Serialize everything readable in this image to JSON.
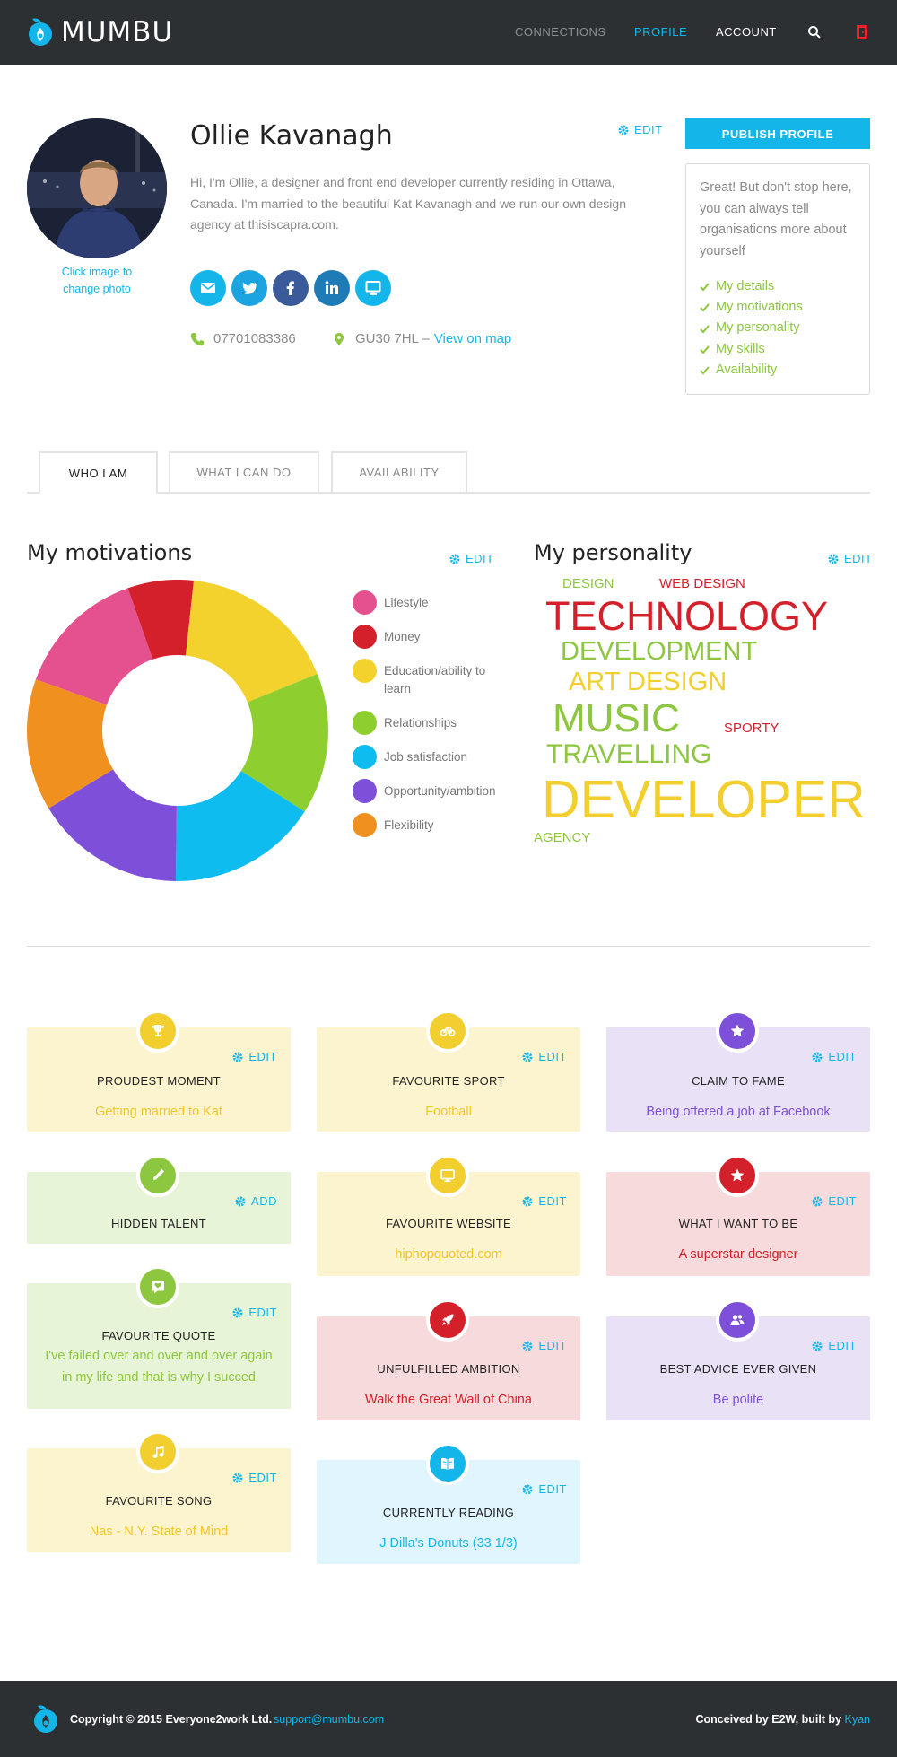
{
  "app": {
    "name": "MUMBU"
  },
  "nav": {
    "connections": "CONNECTIONS",
    "profile": "PROFILE",
    "account": "ACCOUNT",
    "search_icon": "search-icon",
    "logout_icon": "logout-icon"
  },
  "profile": {
    "name": "Ollie Kavanagh",
    "edit_label": "EDIT",
    "avatar_hint": "Click image to change photo",
    "bio": "Hi, I'm Ollie, a designer and front end developer currently residing in Ottawa, Canada. I'm married to the beautiful Kat Kavanagh and we run our own design agency at thisiscapra.com.",
    "social": [
      {
        "icon": "email-icon",
        "color": "#14b6ea"
      },
      {
        "icon": "twitter-icon",
        "color": "#1ba4e0"
      },
      {
        "icon": "facebook-icon",
        "color": "#3b5a9a"
      },
      {
        "icon": "linkedin-icon",
        "color": "#1f7bb6"
      },
      {
        "icon": "website-icon",
        "color": "#14b6ea"
      }
    ],
    "phone": "07701083386",
    "postcode": "GU30 7HL –",
    "map_link": "View on map"
  },
  "publish": {
    "button_label": "PUBLISH PROFILE",
    "message": "Great! But don't stop here, you can always tell organisations more about yourself",
    "checklist": [
      "My details",
      "My motivations",
      "My personality",
      "My skills",
      "Availability"
    ]
  },
  "tabs": [
    {
      "label": "WHO I AM",
      "active": true
    },
    {
      "label": "WHAT I CAN DO",
      "active": false
    },
    {
      "label": "AVAILABILITY",
      "active": false
    }
  ],
  "motivations": {
    "title": "My motivations",
    "edit_label": "EDIT",
    "chart_data": {
      "type": "pie",
      "categories": [
        "Lifestyle",
        "Money",
        "Education/ability to learn",
        "Relationships",
        "Job satisfaction",
        "Opportunity/ambition",
        "Flexibility"
      ],
      "values": [
        14,
        7,
        17,
        15,
        16,
        16,
        14
      ],
      "colors": [
        "#e5508f",
        "#d4202a",
        "#f4d22e",
        "#8ecf2f",
        "#0ebcf0",
        "#7e4fd8",
        "#ef901f"
      ],
      "title": "",
      "xlabel": "",
      "ylabel": ""
    }
  },
  "personality": {
    "title": "My personality",
    "edit_label": "EDIT",
    "words": [
      {
        "text": "DESIGN",
        "color": "#8dc63f"
      },
      {
        "text": "WEB DESIGN",
        "color": "#d4202a"
      },
      {
        "text": "TECHNOLOGY",
        "color": "#d4202a"
      },
      {
        "text": "DEVELOPMENT",
        "color": "#8dc63f"
      },
      {
        "text": "ART DESIGN",
        "color": "#f2ce2e"
      },
      {
        "text": "MUSIC",
        "color": "#8dc63f"
      },
      {
        "text": "SPORTY",
        "color": "#d4202a"
      },
      {
        "text": "TRAVELLING",
        "color": "#8dc63f"
      },
      {
        "text": "DEVELOPER",
        "color": "#f2ce2e"
      },
      {
        "text": "AGENCY",
        "color": "#8dc63f"
      }
    ]
  },
  "cards": [
    {
      "title": "PROUDEST MOMENT",
      "value": "Getting married to Kat",
      "action": "EDIT",
      "icon": "trophy-icon"
    },
    {
      "title": "FAVOURITE SPORT",
      "value": "Football",
      "action": "EDIT",
      "icon": "bicycle-icon"
    },
    {
      "title": "CLAIM TO FAME",
      "value": "Being offered a job at Facebook",
      "action": "EDIT",
      "icon": "star-icon"
    },
    {
      "title": "HIDDEN TALENT",
      "value": "",
      "action": "ADD",
      "icon": "pencil-icon"
    },
    {
      "title": "FAVOURITE WEBSITE",
      "value": "hiphopquoted.com",
      "action": "EDIT",
      "icon": "monitor-icon"
    },
    {
      "title": "WHAT I WANT TO BE",
      "value": "A superstar designer",
      "action": "EDIT",
      "icon": "star-icon"
    },
    {
      "title": "FAVOURITE QUOTE",
      "value": "I've failed over and over and over again in my life and that is why I succed",
      "action": "EDIT",
      "icon": "quote-icon"
    },
    {
      "title": "UNFULFILLED AMBITION",
      "value": "Walk the Great Wall of China",
      "action": "EDIT",
      "icon": "rocket-icon"
    },
    {
      "title": "BEST ADVICE EVER GIVEN",
      "value": "Be polite",
      "action": "EDIT",
      "icon": "people-icon"
    },
    {
      "title": "FAVOURITE SONG",
      "value": "Nas - N.Y. State of Mind",
      "action": "EDIT",
      "icon": "music-icon"
    },
    {
      "title": "CURRENTLY READING",
      "value": "J Dilla's Donuts (33 1/3)",
      "action": "EDIT",
      "icon": "book-icon"
    }
  ],
  "colors": {
    "accent": "#14b6ea",
    "yellow_bg": "#fbf4cf",
    "yellow_fg": "#f2ce2e",
    "purple_bg": "#e9e2f7",
    "purple_fg": "#7e4fd8",
    "green_bg": "#e8f4d8",
    "green_fg": "#8dc63f",
    "red_bg": "#f7dadb",
    "red_fg": "#d4202a",
    "blue_bg": "#e0f5fd",
    "blue_fg": "#14b6ea"
  },
  "footer": {
    "copyright": "Copyright © 2015 Everyone2work Ltd.",
    "email": "support@mumbu.com",
    "credit": "Conceived by E2W, built by",
    "credit_link": "Kyan"
  }
}
